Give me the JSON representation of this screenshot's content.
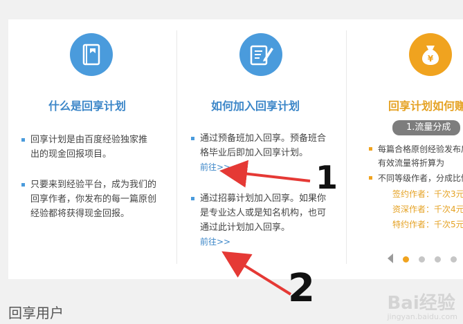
{
  "columns": [
    {
      "icon": "book-icon",
      "title": "什么是回享计划",
      "bullets": [
        {
          "text": "回享计划是由百度经验独家推出的现金回报项目。"
        },
        {
          "text": "只要来到经验平台，成为我们的回享作者，你发布的每一篇原创经验都将获得现金回报。"
        }
      ]
    },
    {
      "icon": "edit-document-icon",
      "title": "如何加入回享计划",
      "bullets": [
        {
          "text": "通过预备班加入回享。预备班合格毕业后即加入回享计划。",
          "link": "前往>>"
        },
        {
          "text": "通过招募计划加入回享。如果你是专业达人或是知名机构，也可通过此计划加入回享。",
          "link": "前往>>"
        }
      ]
    },
    {
      "icon": "money-bag-icon",
      "title": "回享计划如何赚",
      "pill": "1.流量分成",
      "bullets": [
        {
          "text": "每篇合格原创经验发布后，每天的有效流量将折算为"
        },
        {
          "text": "不同等级作者，分成比例"
        }
      ],
      "tiers": [
        "签约作者：千次3元",
        "资深作者：千次4元",
        "特约作者：千次5元"
      ]
    }
  ],
  "pagination": {
    "total": 4,
    "active": 0
  },
  "footer": {
    "title": "回享用户"
  },
  "annotations": {
    "label_1": "1",
    "label_2": "2"
  },
  "watermark": {
    "text": "Bai经验",
    "url": "jingyan.baidu.com"
  },
  "colors": {
    "blue": "#4a9bdc",
    "orange": "#f0a31f",
    "title_blue": "#3b86c8",
    "title_orange": "#e5a224",
    "arrow_red": "#e53935"
  }
}
